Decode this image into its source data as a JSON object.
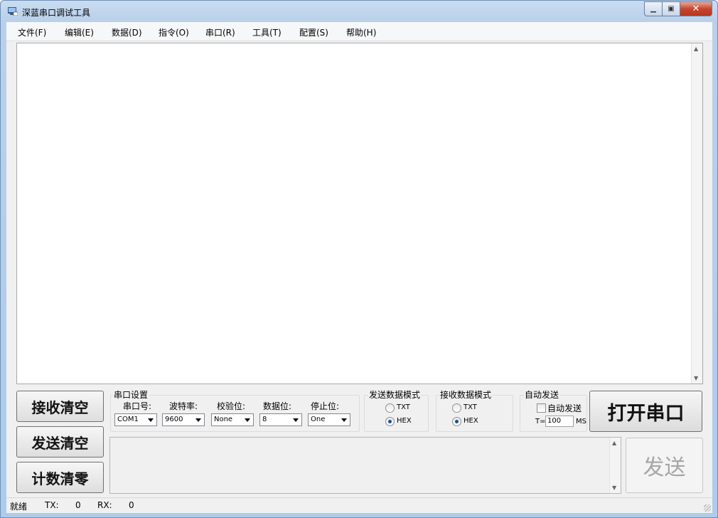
{
  "window": {
    "title": "深蓝串口调试工具",
    "close_label": "✕"
  },
  "menu": [
    "文件(F)",
    "编辑(E)",
    "数据(D)",
    "指令(O)",
    "串口(R)",
    "工具(T)",
    "配置(S)",
    "帮助(H)"
  ],
  "buttons": {
    "clear_recv": "接收清空",
    "clear_send": "发送清空",
    "clear_count": "计数清零",
    "open_port": "打开串口",
    "send": "发送"
  },
  "port_settings": {
    "group_label": "串口设置",
    "port": {
      "label": "串口号:",
      "value": "COM1"
    },
    "baud": {
      "label": "波特率:",
      "value": "9600"
    },
    "parity": {
      "label": "校验位:",
      "value": "None"
    },
    "databits": {
      "label": "数据位:",
      "value": "8"
    },
    "stopbits": {
      "label": "停止位:",
      "value": "One"
    }
  },
  "send_mode": {
    "group_label": "发送数据模式",
    "txt": "TXT",
    "hex": "HEX",
    "selected": "HEX"
  },
  "recv_mode": {
    "group_label": "接收数据模式",
    "txt": "TXT",
    "hex": "HEX",
    "selected": "HEX"
  },
  "auto_send": {
    "group_label": "自动发送",
    "checkbox_label": "自动发送",
    "checked": false,
    "interval_prefix": "T=",
    "interval_value": "100",
    "unit": "MS"
  },
  "status": {
    "state": "就绪",
    "tx_label": "TX:",
    "tx_value": "0",
    "rx_label": "RX:",
    "rx_value": "0"
  }
}
